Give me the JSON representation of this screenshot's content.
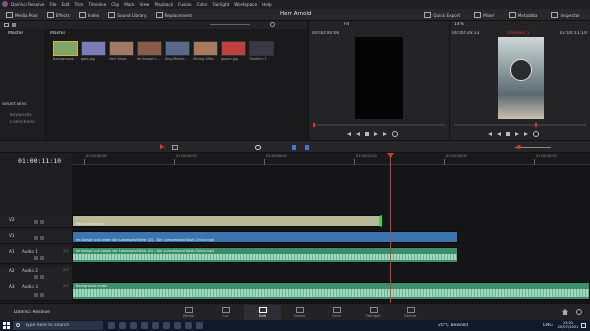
{
  "app": {
    "logo_label": "DaVinci Resolve",
    "title": "Herr Arnold",
    "status_badge": "Edited"
  },
  "menu": {
    "items": [
      "DaVinci Resolve",
      "File",
      "Edit",
      "Trim",
      "Timeline",
      "Clip",
      "Mark",
      "View",
      "Playback",
      "Fusion",
      "Color",
      "Fairlight",
      "Workspace",
      "Help"
    ]
  },
  "toolbar": {
    "left": [
      "Media Pool",
      "Effects",
      "Index",
      "Sound Library",
      "Replacement"
    ],
    "right": [
      "Quick Export",
      "Mixer",
      "Metadata",
      "Inspector"
    ]
  },
  "media_pool": {
    "header": "Master",
    "bin_header": "Master",
    "smart_bins": "Smart Bins",
    "smart_items": [
      "Keywords",
      "Collections"
    ],
    "zoom": "Z",
    "thumbs": [
      {
        "label": "Background...",
        "color": "#7ea668"
      },
      {
        "label": "gato.jpg",
        "color": "#7d7ab8"
      },
      {
        "label": "Herr Arnol...",
        "color": "#a07a66"
      },
      {
        "label": "Im Kampf u...",
        "color": "#8a5a4a"
      },
      {
        "label": "King Mieter...",
        "color": "#5a6a8a"
      },
      {
        "label": "Mining Alfre...",
        "color": "#a67a5a"
      },
      {
        "label": "queen.jpg",
        "color": "#c04040"
      },
      {
        "label": "Timeline 1",
        "color": "#3a3a44"
      }
    ]
  },
  "source_viewer": {
    "timecode_left": "00:00:00:00",
    "fit": "Fit",
    "timecode_right": "00:00:00:00",
    "duration": "00:00:26:13"
  },
  "timeline_viewer": {
    "zoom": "14%",
    "timeline_name": "Timeline 1",
    "timecode": "01:00:11:10"
  },
  "timeline": {
    "timecode": "01:00:11:10",
    "ruler": [
      "01:00:00:00",
      "01:00:04:00",
      "01:00:08:00",
      "01:00:12:00",
      "01:00:16:00",
      "01:00:20:00"
    ],
    "playhead_pct": 61.4,
    "tracks": [
      {
        "id": "V2",
        "name": "",
        "clip": "Herr Arnold.png"
      },
      {
        "id": "V1",
        "name": "",
        "clip": "Im Kampf und Leben der Lokomotivführer (D) - Der Lumumband Nach China.mp4"
      },
      {
        "id": "A1",
        "name": "Audio 1",
        "level": "2.0",
        "clip": "Im Kampf und Leben der Lokomotivführer (D) - Der Lumumband Nach China.mp4"
      },
      {
        "id": "A2",
        "name": "Audio 2",
        "level": "2.0",
        "clip": ""
      },
      {
        "id": "A3",
        "name": "Audio 3",
        "level": "2.0",
        "clip": "Background music"
      }
    ]
  },
  "pages": [
    "Media",
    "Cut",
    "Edit",
    "Fusion",
    "Color",
    "Fairlight",
    "Deliver"
  ],
  "active_page": "Edit",
  "taskbar": {
    "search_placeholder": "Type here to search",
    "weather": "20°C",
    "weather_desc": "Bewölkt",
    "lang": "ENG",
    "time": "13:01",
    "date": "20/07/2021"
  },
  "colors": {
    "accent_red": "#e0332e",
    "video_clip": "#3a75b0",
    "audio_clip": "#3c8f6a",
    "still_clip": "#b8b896"
  }
}
